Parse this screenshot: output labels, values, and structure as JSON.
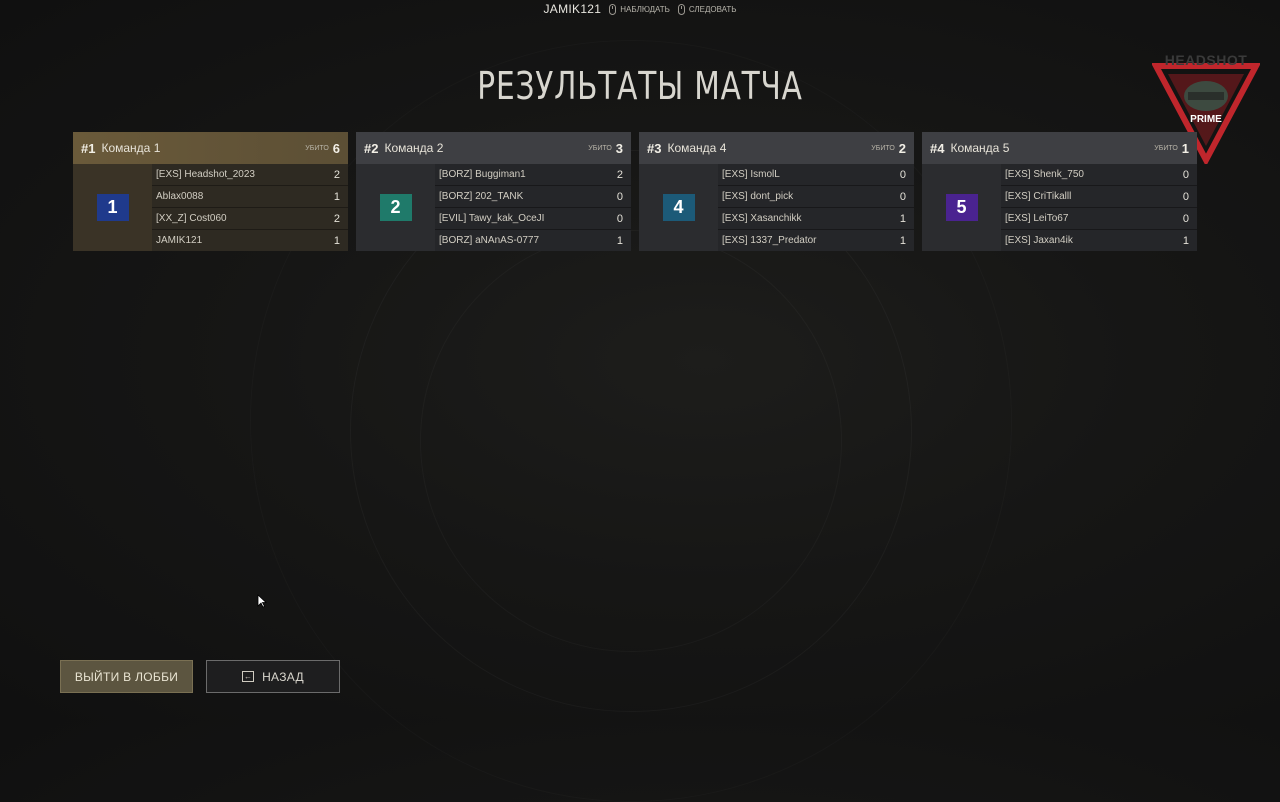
{
  "topbar": {
    "player_name": "JAMIK121",
    "hints": [
      {
        "icon": "mouse-left-icon",
        "label": "НАБЛЮДАТЬ"
      },
      {
        "icon": "mouse-right-icon",
        "label": "СЛЕДОВАТЬ"
      }
    ]
  },
  "page_title": "РЕЗУЛЬТАТЫ МАТЧА",
  "logo": {
    "brand_top": "HEADSHOT",
    "brand_bottom": "PRIME"
  },
  "kills_label": "УБИТО",
  "teams": [
    {
      "rank": "#1",
      "name": "Команда 1",
      "kills": "6",
      "badge": "1",
      "badge_color": "#1f3a8c",
      "players": [
        {
          "name": "[EXS] Headshot_2023",
          "kills": "2"
        },
        {
          "name": "Ablax0088",
          "kills": "1"
        },
        {
          "name": "[XX_Z] Cost060",
          "kills": "2"
        },
        {
          "name": "JAMIK121",
          "kills": "1"
        }
      ]
    },
    {
      "rank": "#2",
      "name": "Команда 2",
      "kills": "3",
      "badge": "2",
      "badge_color": "#1f7a6a",
      "players": [
        {
          "name": "[BORZ] Buggiman1",
          "kills": "2"
        },
        {
          "name": "[BORZ] 202_TANK",
          "kills": "0"
        },
        {
          "name": "[EVIL] Tawy_kak_OceJI",
          "kills": "0"
        },
        {
          "name": "[BORZ] aNAnAS-0777",
          "kills": "1"
        }
      ]
    },
    {
      "rank": "#3",
      "name": "Команда 4",
      "kills": "2",
      "badge": "4",
      "badge_color": "#1c5a78",
      "players": [
        {
          "name": "[EXS] IsmolL",
          "kills": "0"
        },
        {
          "name": "[EXS] dont_pick",
          "kills": "0"
        },
        {
          "name": "[EXS] Xasanchikk",
          "kills": "1"
        },
        {
          "name": "[EXS] 1337_Predator",
          "kills": "1"
        }
      ]
    },
    {
      "rank": "#4",
      "name": "Команда 5",
      "kills": "1",
      "badge": "5",
      "badge_color": "#4a2390",
      "players": [
        {
          "name": "[EXS] Shenk_750",
          "kills": "0"
        },
        {
          "name": "[EXS] CriTikalll",
          "kills": "0"
        },
        {
          "name": "[EXS] LeiTo67",
          "kills": "0"
        },
        {
          "name": "[EXS] Jaxan4ik",
          "kills": "1"
        }
      ]
    }
  ],
  "buttons": {
    "exit_lobby": "ВЫЙТИ В ЛОББИ",
    "back": "НАЗАД"
  }
}
